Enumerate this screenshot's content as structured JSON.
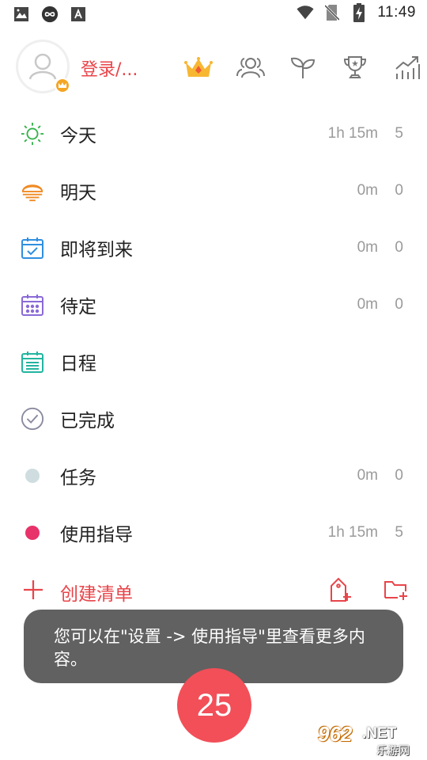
{
  "status_bar": {
    "time": "11:49",
    "left_icons": [
      "image-icon",
      "infinity-app-icon",
      "font-app-icon"
    ],
    "right_icons": [
      "wifi-icon",
      "no-sim-icon",
      "battery-charging-icon"
    ]
  },
  "header": {
    "login_label": "登录/...",
    "icons": [
      "crown-icon",
      "team-icon",
      "sprout-icon",
      "trophy-icon",
      "statistics-icon"
    ]
  },
  "list": {
    "items": [
      {
        "label": "今天",
        "time": "1h 15m",
        "count": "5",
        "icon": "sun-icon"
      },
      {
        "label": "明天",
        "time": "0m",
        "count": "0",
        "icon": "sunrise-icon"
      },
      {
        "label": "即将到来",
        "time": "0m",
        "count": "0",
        "icon": "calendar-check-icon"
      },
      {
        "label": "待定",
        "time": "0m",
        "count": "0",
        "icon": "calendar-dots-icon"
      },
      {
        "label": "日程",
        "time": "",
        "count": "",
        "icon": "calendar-list-icon"
      },
      {
        "label": "已完成",
        "time": "",
        "count": "",
        "icon": "check-circle-icon"
      },
      {
        "label": "任务",
        "time": "0m",
        "count": "0",
        "icon": "dot-gray-icon"
      },
      {
        "label": "使用指导",
        "time": "1h 15m",
        "count": "5",
        "icon": "dot-pink-icon"
      }
    ]
  },
  "create": {
    "label": "创建清单"
  },
  "toast": {
    "text": "您可以在\"设置 -> 使用指导\"里查看更多内容。"
  },
  "fab": {
    "value": "25"
  },
  "watermark": {
    "number": "962",
    "domain": ".NET",
    "sub": "乐游网"
  },
  "colors": {
    "accent": "#e8454a",
    "fab": "#f24f58",
    "sun": "#35b34a",
    "sunrise": "#f08a24",
    "calendar_blue": "#2f8fe0",
    "calendar_purple": "#8a6ad6",
    "calendar_teal": "#22b5a0",
    "check_gray": "#8a8aa0",
    "dot_gray": "#cfdde0",
    "dot_pink": "#e8326a"
  }
}
